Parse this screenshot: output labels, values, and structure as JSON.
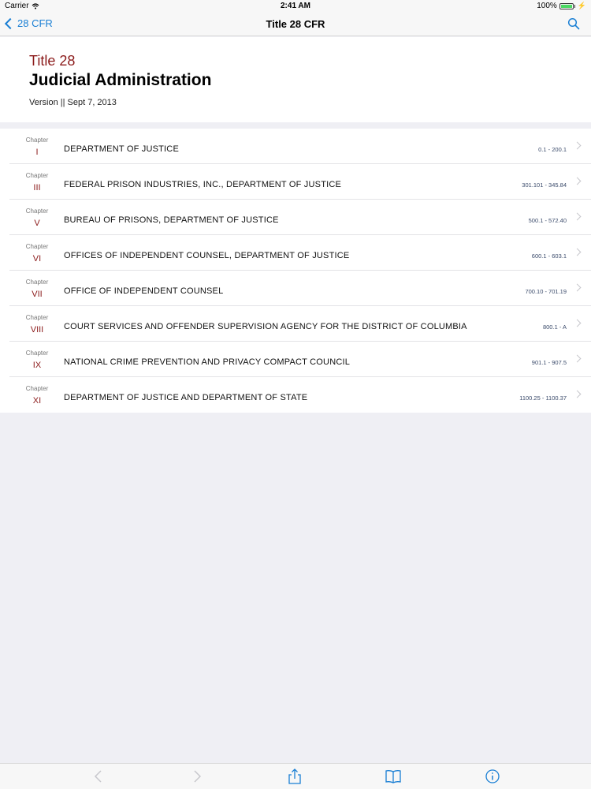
{
  "status_bar": {
    "carrier": "Carrier",
    "time": "2:41 AM",
    "battery": "100%",
    "battery_level": 1.0
  },
  "nav": {
    "back_label": "28 CFR",
    "title": "Title 28 CFR"
  },
  "header": {
    "title_number": "Title 28",
    "title_name": "Judicial Administration",
    "version": "Version || Sept 7, 2013"
  },
  "chapters": [
    {
      "label": "Chapter",
      "number": "I",
      "name": "DEPARTMENT OF JUSTICE",
      "range": "0.1 - 200.1"
    },
    {
      "label": "Chapter",
      "number": "III",
      "name": "FEDERAL PRISON INDUSTRIES, INC., DEPARTMENT OF JUSTICE",
      "range": "301.101 - 345.84"
    },
    {
      "label": "Chapter",
      "number": "V",
      "name": "BUREAU OF PRISONS, DEPARTMENT OF JUSTICE",
      "range": "500.1 - 572.40"
    },
    {
      "label": "Chapter",
      "number": "VI",
      "name": "OFFICES OF INDEPENDENT COUNSEL, DEPARTMENT OF JUSTICE",
      "range": "600.1 - 603.1"
    },
    {
      "label": "Chapter",
      "number": "VII",
      "name": "OFFICE OF INDEPENDENT COUNSEL",
      "range": "700.10 - 701.19"
    },
    {
      "label": "Chapter",
      "number": "VIII",
      "name": "COURT SERVICES AND OFFENDER SUPERVISION AGENCY FOR THE DISTRICT OF COLUMBIA",
      "range": "800.1 - A"
    },
    {
      "label": "Chapter",
      "number": "IX",
      "name": "NATIONAL CRIME PREVENTION AND PRIVACY COMPACT COUNCIL",
      "range": "901.1 - 907.5"
    },
    {
      "label": "Chapter",
      "number": "XI",
      "name": "DEPARTMENT OF JUSTICE AND DEPARTMENT OF STATE",
      "range": "1100.25 - 1100.37"
    }
  ],
  "toolbar": {
    "icons": [
      "chevron-left-icon",
      "chevron-right-icon",
      "share-icon",
      "book-icon",
      "info-icon"
    ]
  },
  "colors": {
    "accent_blue": "#1a7fd4",
    "title_red": "#8b1a1a",
    "background": "#efeff4"
  }
}
